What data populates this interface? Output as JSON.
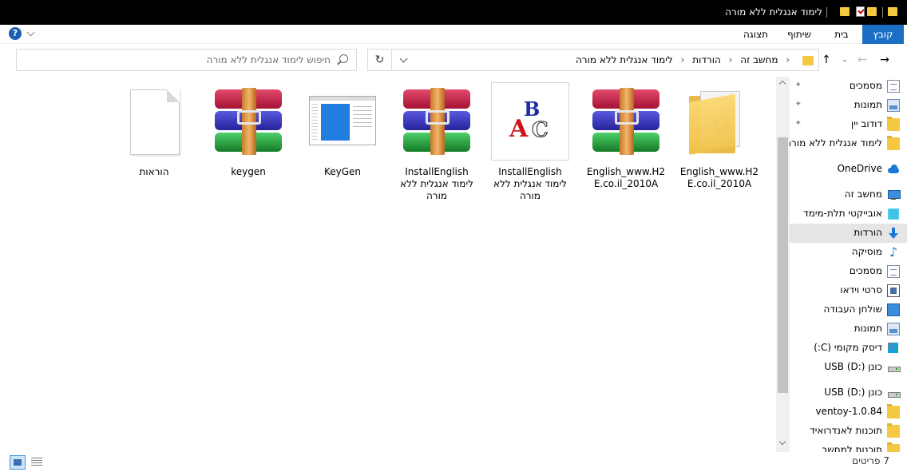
{
  "window": {
    "title": "לימוד אנגלית ללא מורה"
  },
  "ribbon": {
    "tabs": [
      {
        "label": "קובץ",
        "active": true
      },
      {
        "label": "בית",
        "active": false
      },
      {
        "label": "שיתוף",
        "active": false
      },
      {
        "label": "תצוגה",
        "active": false
      }
    ],
    "help_label": "?"
  },
  "address": {
    "crumbs": [
      "מחשב זה",
      "הורדות",
      "לימוד אנגלית ללא מורה"
    ],
    "search_placeholder": "חיפוש לימוד אנגלית ללא מורה"
  },
  "sidebar": {
    "items": [
      {
        "label": "מסמכים",
        "icon": "documents-icon",
        "pinned": true
      },
      {
        "label": "תמונות",
        "icon": "pictures-icon",
        "pinned": true
      },
      {
        "label": "דודוב יין",
        "icon": "folder-icon",
        "pinned": true
      },
      {
        "label": "לימוד אנגלית ללא מורה",
        "icon": "folder-icon",
        "pinned": false
      },
      {
        "label": "OneDrive",
        "icon": "onedrive-icon",
        "pinned": false
      },
      {
        "label": "מחשב זה",
        "icon": "this-pc-icon",
        "pinned": false
      },
      {
        "label": "אובייקטי תלת-מימד",
        "icon": "3d-objects-icon",
        "pinned": false
      },
      {
        "label": "הורדות",
        "icon": "downloads-icon",
        "pinned": false,
        "selected": true
      },
      {
        "label": "מוסיקה",
        "icon": "music-icon",
        "pinned": false
      },
      {
        "label": "מסמכים",
        "icon": "documents-icon",
        "pinned": false
      },
      {
        "label": "סרטי וידאו",
        "icon": "videos-icon",
        "pinned": false
      },
      {
        "label": "שולחן העבודה",
        "icon": "desktop-icon",
        "pinned": false
      },
      {
        "label": "תמונות",
        "icon": "pictures-icon",
        "pinned": false
      },
      {
        "label": "דיסק מקומי (C:)",
        "icon": "local-disk-icon",
        "pinned": false
      },
      {
        "label": "כונן USB (D:)",
        "icon": "usb-drive-icon",
        "pinned": false
      },
      {
        "label": "כונן USB (D:)",
        "icon": "usb-drive-icon",
        "pinned": false
      },
      {
        "label": "ventoy-1.0.84",
        "icon": "folder-icon",
        "pinned": false
      },
      {
        "label": "תוכנות לאנדרואיד",
        "icon": "folder-icon",
        "pinned": false
      },
      {
        "label": "תוכנות למחשב",
        "icon": "folder-icon",
        "pinned": false
      }
    ]
  },
  "files": [
    {
      "name": "English_www.H2E.co.il_2010A",
      "name_he": "",
      "icon": "open-folder-icon"
    },
    {
      "name": "English_www.H2E.co.il_2010A",
      "name_he": "",
      "icon": "winrar-archive-icon"
    },
    {
      "name": "InstallEnglish",
      "name_he": "לימוד אנגלית ללא מורה",
      "icon": "setup-abc-icon",
      "selected": true
    },
    {
      "name": "InstallEnglish",
      "name_he": "לימוד אנגלית ללא מורה",
      "icon": "winrar-archive-icon"
    },
    {
      "name": "KeyGen",
      "name_he": "",
      "icon": "window-thumbnail-icon"
    },
    {
      "name": "keygen",
      "name_he": "",
      "icon": "winrar-archive-icon"
    },
    {
      "name": "",
      "name_he": "הוראות",
      "icon": "text-document-icon"
    }
  ],
  "status": {
    "item_count": "7 פריטים"
  },
  "colors": {
    "accent": "#1a6fc4",
    "selection": "#e5e5e5",
    "folder": "#f5c842"
  }
}
